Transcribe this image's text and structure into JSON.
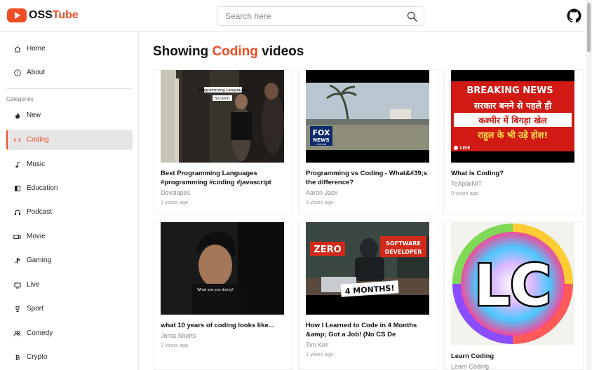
{
  "brand": {
    "oss": "OSS",
    "tube": "Tube"
  },
  "search": {
    "placeholder": "Search here"
  },
  "sidebar": {
    "home": "Home",
    "about": "About",
    "categories_title": "Categories",
    "categories": [
      "New",
      "Coding",
      "Music",
      "Education",
      "Podcast",
      "Movie",
      "Gaming",
      "Live",
      "Sport",
      "Comedy",
      "Crypto"
    ],
    "active": "Coding"
  },
  "page": {
    "prefix": "Showing",
    "category": "Coding",
    "suffix": "videos"
  },
  "videos": [
    {
      "title": "Best Programming Languages #programming #coding #javascript",
      "channel": "Devslopes",
      "time": "1 years ago",
      "thumb_text": [
        "Programming Languages",
        "Scratch"
      ]
    },
    {
      "title": "Programming vs Coding - What&#39;s the difference?",
      "channel": "Aaron Jack",
      "time": "3 years ago",
      "thumb_text": [
        "FOX",
        "NEWS",
        "channel"
      ]
    },
    {
      "title": "What is Coding?",
      "channel": "TeXplaiNIT",
      "time": "9 years ago",
      "thumb_text": [
        "BREAKING NEWS",
        "सरकार बनने से पहले ही",
        "कश्मीर में बिगड़ा खेल",
        "राहुल के भी उड़े होश!",
        "LIVE"
      ]
    },
    {
      "title": "what 10 years of coding looks like...",
      "channel": "Joma Shorts",
      "time": "2 years ago",
      "thumb_text": [
        "What are you doing?"
      ]
    },
    {
      "title": "How I Learned to Code in 4 Months &amp; Got a Job! (No CS De",
      "channel": "Tim Kim",
      "time": "1 years ago",
      "thumb_text": [
        "ZERO",
        "SOFTWARE",
        "DEVELOPER",
        "4 MONTHS!"
      ]
    },
    {
      "title": "Learn Coding",
      "channel": "Learn Coding",
      "time": "",
      "thumb_text": [
        "LC"
      ]
    }
  ],
  "colors": {
    "accent": "#ef4d23",
    "active_bg": "#e6e6e6"
  }
}
